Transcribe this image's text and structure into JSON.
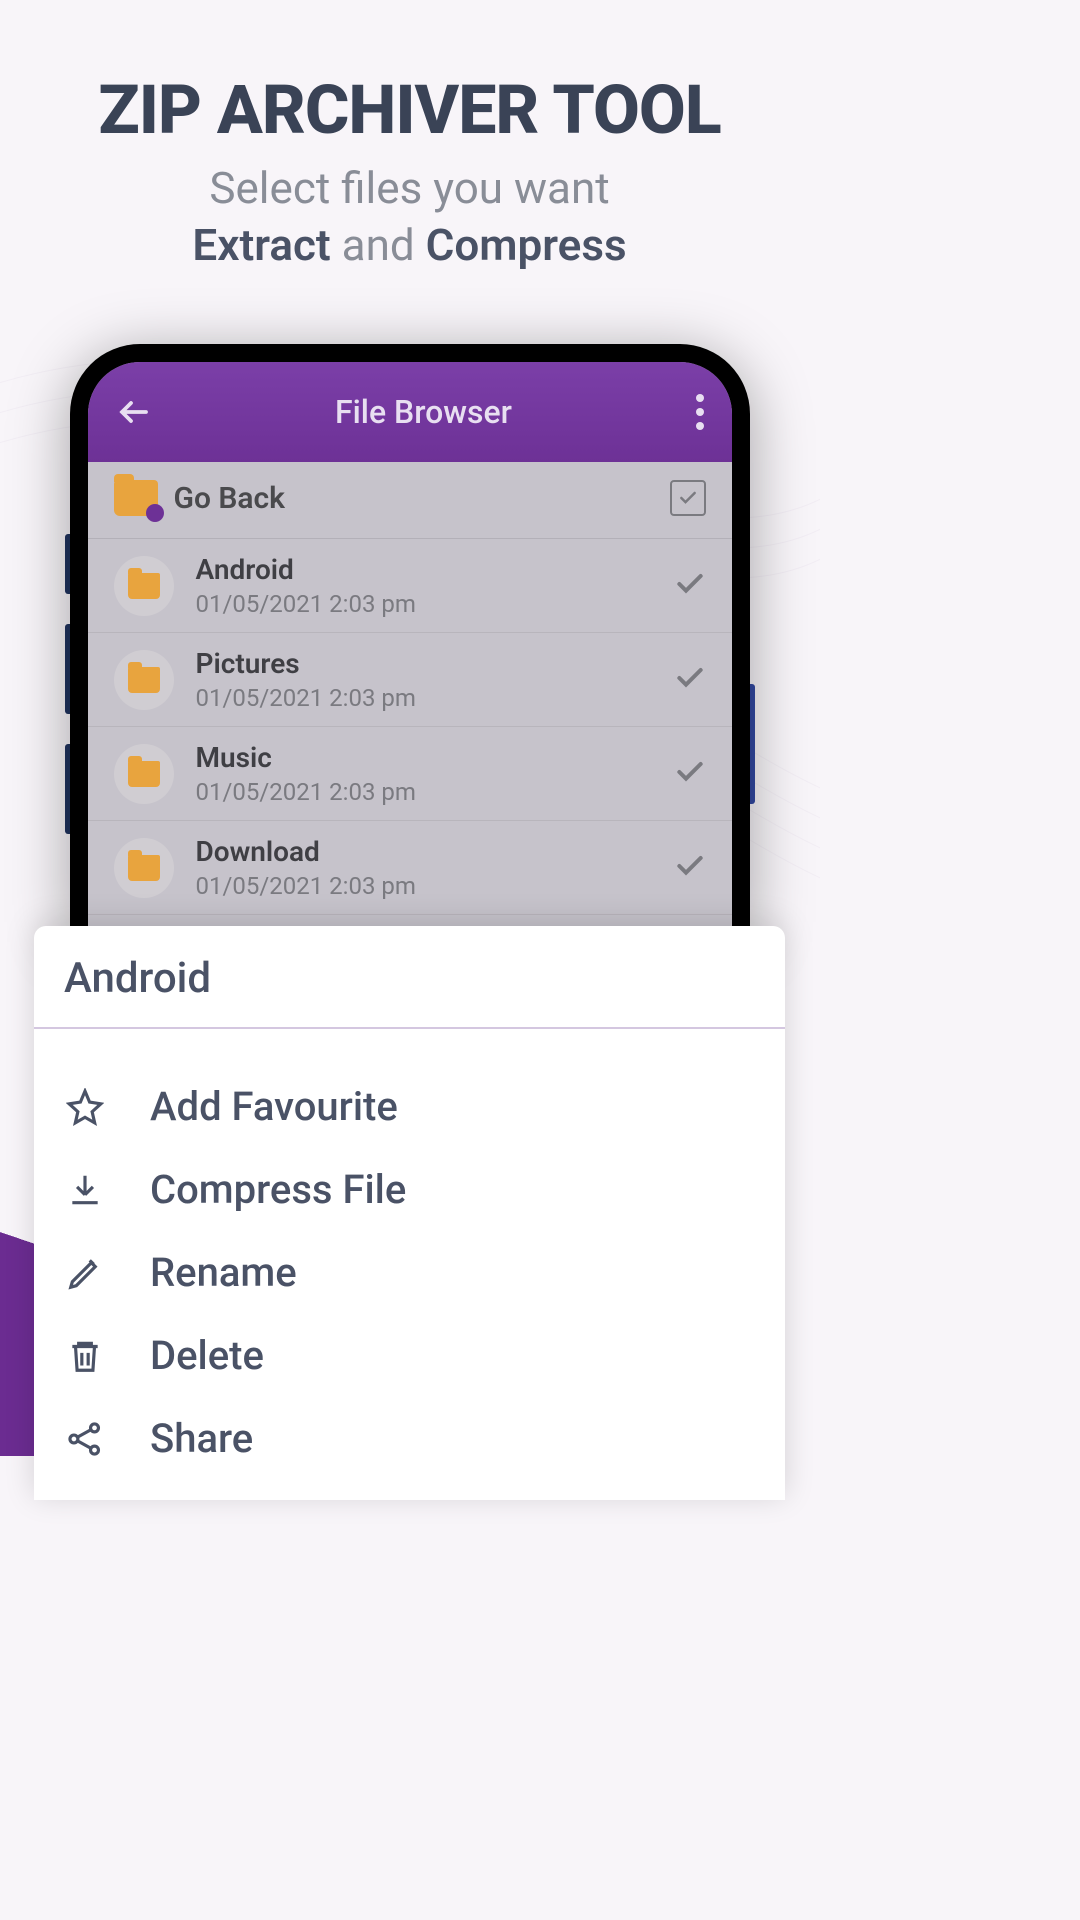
{
  "header": {
    "title": "ZIP ARCHIVER TOOL",
    "subtitle_line1": "Select files you want",
    "subtitle_bold1": "Extract",
    "subtitle_mid": " and ",
    "subtitle_bold2": "Compress"
  },
  "app": {
    "title": "File Browser",
    "go_back": "Go Back",
    "files": [
      {
        "name": "Android",
        "date": "01/05/2021  2:03 pm"
      },
      {
        "name": "Pictures",
        "date": "01/05/2021  2:03 pm"
      },
      {
        "name": "Music",
        "date": "01/05/2021  2:03 pm"
      },
      {
        "name": "Download",
        "date": "01/05/2021  2:03 pm"
      }
    ]
  },
  "sheet": {
    "title": "Android",
    "items": [
      {
        "label": "Add Favourite"
      },
      {
        "label": "Compress File"
      },
      {
        "label": "Rename"
      },
      {
        "label": "Delete"
      },
      {
        "label": "Share"
      }
    ]
  }
}
